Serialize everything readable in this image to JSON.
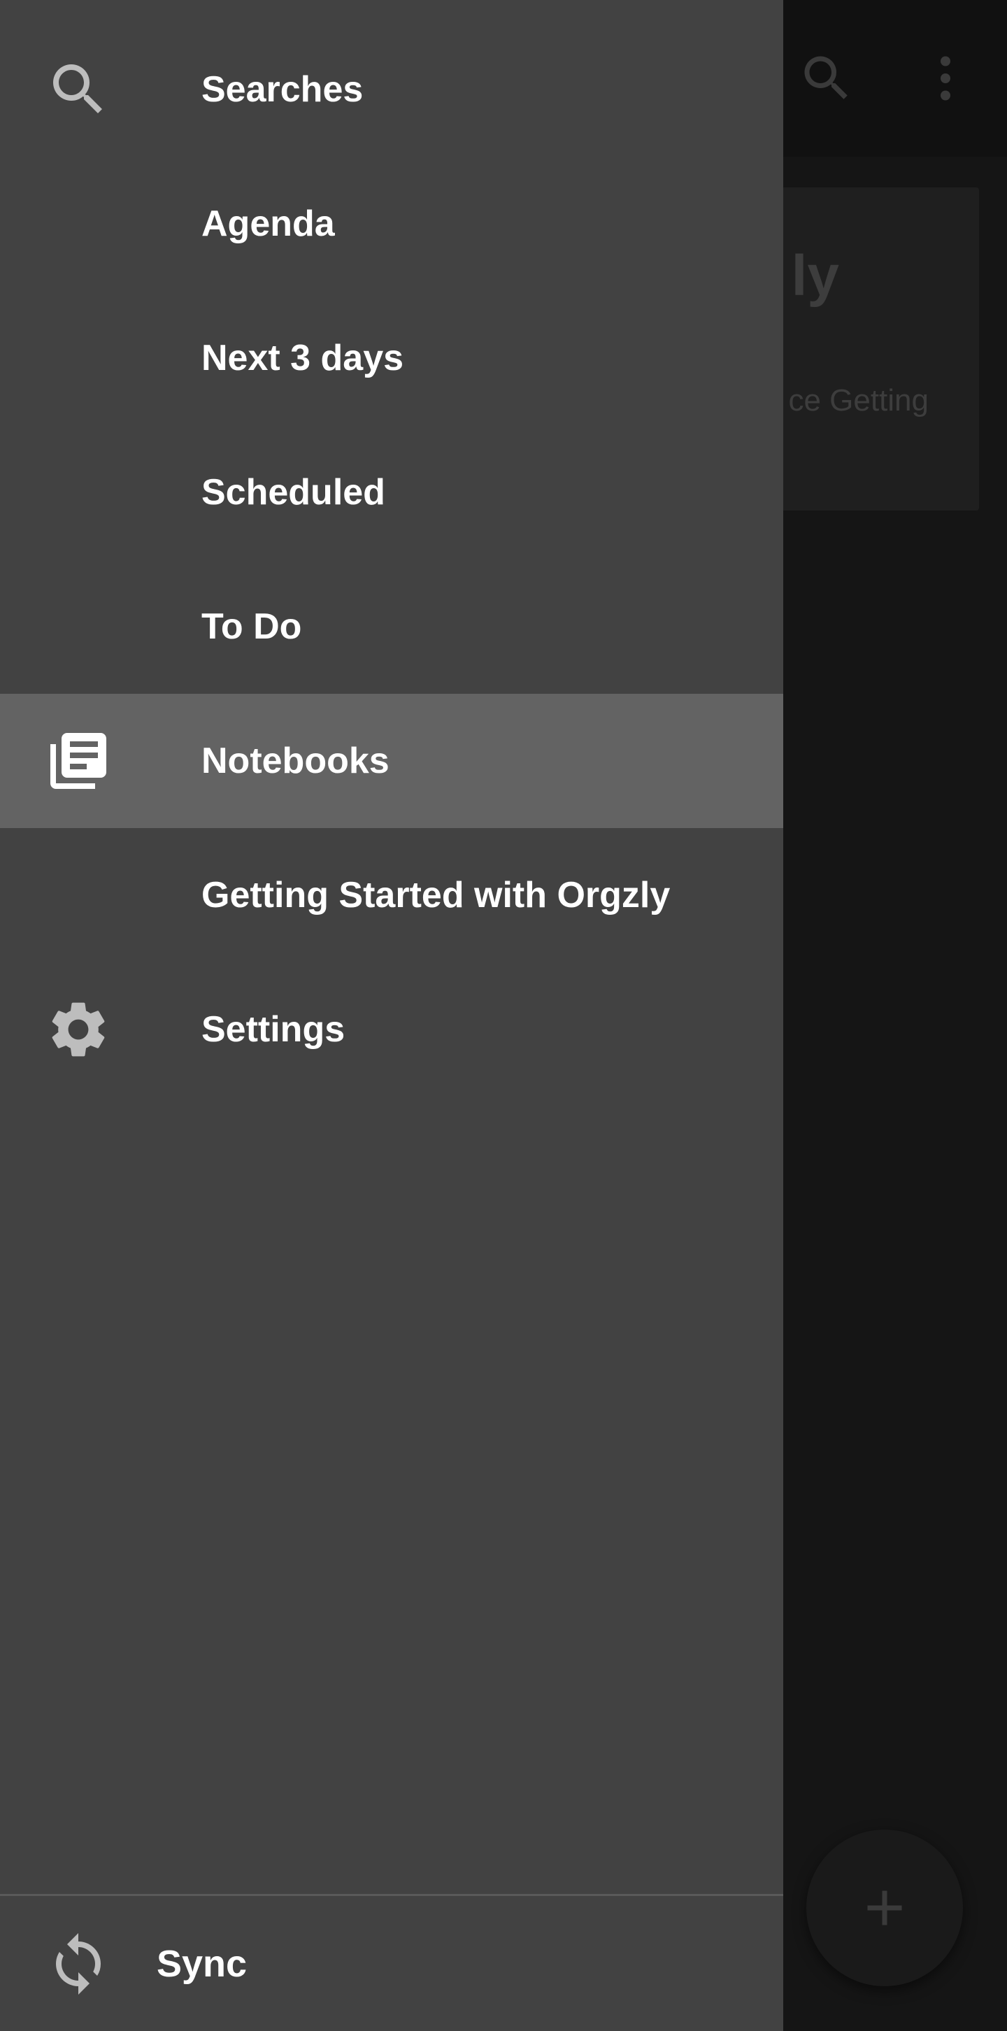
{
  "background_page": {
    "card": {
      "title_partial": "ly",
      "text_partial": "ce Getting"
    }
  },
  "drawer": {
    "items": [
      {
        "label": "Searches",
        "icon": "search-icon",
        "active": false
      },
      {
        "label": "Agenda",
        "icon": null,
        "active": false
      },
      {
        "label": "Next 3 days",
        "icon": null,
        "active": false
      },
      {
        "label": "Scheduled",
        "icon": null,
        "active": false
      },
      {
        "label": "To Do",
        "icon": null,
        "active": false
      },
      {
        "label": "Notebooks",
        "icon": "notebooks-icon",
        "active": true
      },
      {
        "label": "Getting Started with Orgzly",
        "icon": null,
        "active": false
      },
      {
        "label": "Settings",
        "icon": "gear-icon",
        "active": false
      }
    ],
    "sync": {
      "label": "Sync",
      "icon": "sync-icon"
    }
  },
  "colors": {
    "drawer_bg": "#424242",
    "active_item_bg": "#636363",
    "text": "#ffffff",
    "icon": "#bdbdbd",
    "scrim_bg": "#151515"
  }
}
